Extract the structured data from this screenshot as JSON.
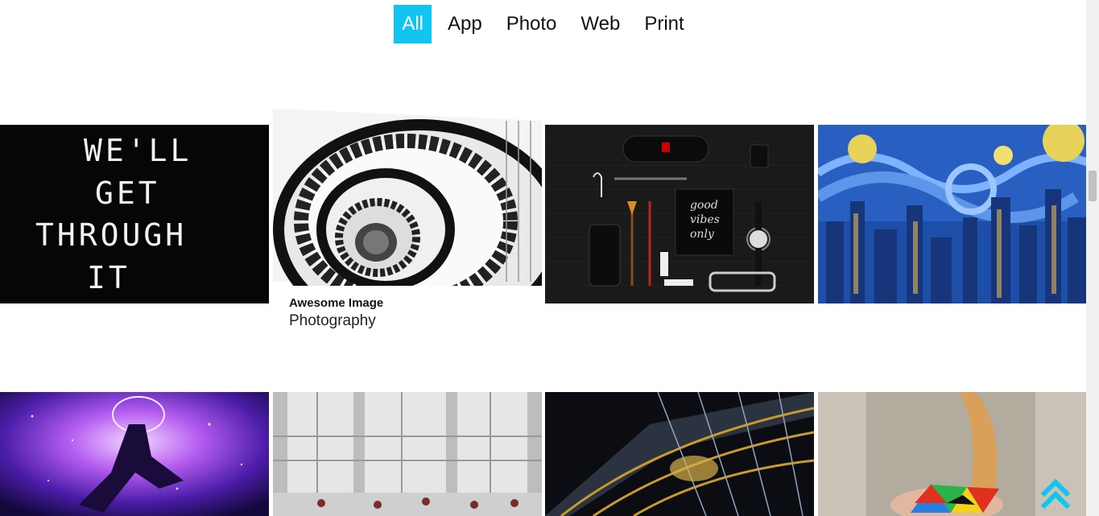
{
  "filters": [
    {
      "label": "All",
      "active": true
    },
    {
      "label": "App",
      "active": false
    },
    {
      "label": "Photo",
      "active": false
    },
    {
      "label": "Web",
      "active": false
    },
    {
      "label": "Print",
      "active": false
    }
  ],
  "gallery": {
    "tiles": [
      {
        "id": "well-get-through-it",
        "text_lines": [
          "WE'LL",
          "GET",
          "THROUGH",
          "IT"
        ]
      },
      {
        "id": "spiral-staircase",
        "hovered": true
      },
      {
        "id": "flatlay-gadgets",
        "notebook_lines": [
          "good",
          "vibes",
          "only"
        ]
      },
      {
        "id": "starry-city"
      },
      {
        "id": "cosmic-figure"
      },
      {
        "id": "atrium-windows"
      },
      {
        "id": "escalator-tunnel"
      },
      {
        "id": "rubiks-pyramid"
      }
    ],
    "hover_caption": {
      "title": "Awesome Image",
      "subtitle": "Photography"
    }
  },
  "colors": {
    "accent": "#12c5f1",
    "text": "#111111"
  },
  "icons": {
    "back_to_top": "chevron-double-up-icon"
  }
}
